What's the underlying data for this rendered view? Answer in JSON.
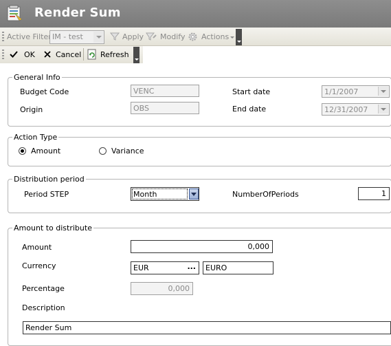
{
  "window": {
    "title": "Render Sum"
  },
  "filterbar": {
    "active_filter_label": "Active Filter",
    "filter_value": "IM - test",
    "apply_label": "Apply",
    "modify_label": "Modify",
    "actions_label": "Actions"
  },
  "actionbar": {
    "ok_label": "OK",
    "cancel_label": "Cancel",
    "refresh_label": "Refresh"
  },
  "general_info": {
    "legend": "General Info",
    "budget_code_label": "Budget Code",
    "budget_code_value": "VENC",
    "origin_label": "Origin",
    "origin_value": "OBS",
    "start_date_label": "Start date",
    "start_date_value": "1/1/2007",
    "end_date_label": "End date",
    "end_date_value": "12/31/2007"
  },
  "action_type": {
    "legend": "Action Type",
    "amount_label": "Amount",
    "variance_label": "Variance",
    "selected": "Amount"
  },
  "distribution_period": {
    "legend": "Distribution period",
    "period_step_label": "Period STEP",
    "period_step_value": "Month",
    "number_of_periods_label": "NumberOfPeriods",
    "number_of_periods_value": "1"
  },
  "amount_to_distribute": {
    "legend": "Amount to distribute",
    "amount_label": "Amount",
    "amount_value": "0,000",
    "currency_label": "Currency",
    "currency_code": "EUR",
    "currency_name": "EURO",
    "ellipsis": "...",
    "percentage_label": "Percentage",
    "percentage_value": "0,000",
    "description_label": "Description",
    "description_value": "Render Sum"
  }
}
